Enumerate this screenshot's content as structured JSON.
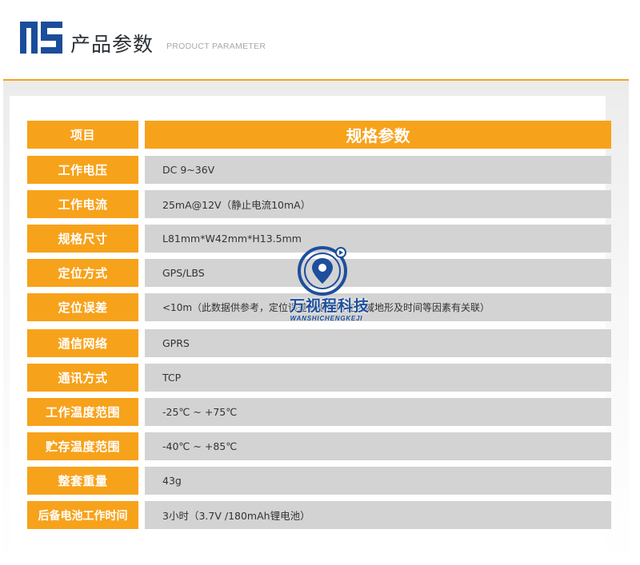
{
  "header": {
    "logo_text": "NS",
    "title_cn": "产品参数",
    "title_en": "PRODUCT PARAMETER"
  },
  "table": {
    "head": {
      "item": "项目",
      "spec": "规格参数"
    },
    "rows": [
      {
        "label": "工作电压",
        "value": "DC 9~36V"
      },
      {
        "label": "工作电流",
        "value": "25mA@12V（静止电流10mA）"
      },
      {
        "label": "规格尺寸",
        "value": "L81mm*W42mm*H13.5mm"
      },
      {
        "label": "定位方式",
        "value": "GPS/LBS"
      },
      {
        "label": "定位误差",
        "value": "<10m（此数据供参考，定位误差会根据所在区域地形及时间等因素有关联）"
      },
      {
        "label": "通信网络",
        "value": "GPRS"
      },
      {
        "label": "通讯方式",
        "value": "TCP"
      },
      {
        "label": "工作温度范围",
        "value": "-25℃ ~ +75℃"
      },
      {
        "label": "贮存温度范围",
        "value": "-40℃ ~ +85℃"
      },
      {
        "label": "整套重量",
        "value": "43g"
      },
      {
        "label": "后备电池工作时间",
        "value": "3小时（3.7V /180mAh锂电池）"
      }
    ]
  },
  "watermark": {
    "text_cn": "万视程科技",
    "text_en": "WANSHICHENGKEJI"
  },
  "colors": {
    "accent_orange": "#f7a21b",
    "cell_gray": "#d3d3d3",
    "logo_blue": "#1b4d9b"
  }
}
